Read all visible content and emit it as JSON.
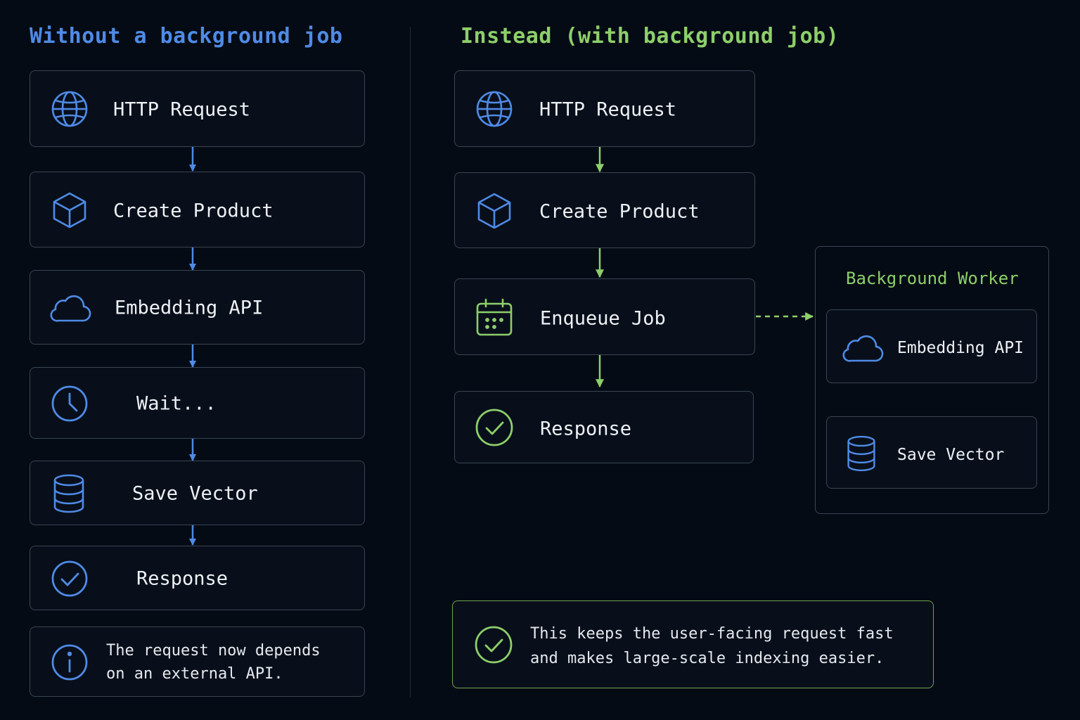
{
  "left": {
    "heading": "Without a background job",
    "steps": [
      {
        "label": "HTTP Request",
        "icon": "globe-icon"
      },
      {
        "label": "Create Product",
        "icon": "cube-icon"
      },
      {
        "label": "Embedding API",
        "icon": "cloud-icon"
      },
      {
        "label": "Wait...",
        "icon": "clock-icon"
      },
      {
        "label": "Save Vector",
        "icon": "database-icon"
      },
      {
        "label": "Response",
        "icon": "check-circle-icon"
      }
    ],
    "note": {
      "icon": "info-icon",
      "lines": [
        "The request now depends",
        "on an external API."
      ]
    }
  },
  "right": {
    "heading": "Instead (with background job)",
    "steps": [
      {
        "label": "HTTP Request",
        "icon": "globe-icon"
      },
      {
        "label": "Create Product",
        "icon": "cube-icon"
      },
      {
        "label": "Enqueue Job",
        "icon": "calendar-icon"
      },
      {
        "label": "Response",
        "icon": "check-circle-icon"
      }
    ],
    "worker": {
      "title": "Background Worker",
      "steps": [
        {
          "label": "Embedding API",
          "icon": "cloud-icon"
        },
        {
          "label": "Save Vector",
          "icon": "database-icon"
        }
      ]
    },
    "note": {
      "icon": "check-circle-icon",
      "lines": [
        "This keeps the user-facing request fast",
        "and makes large-scale indexing easier."
      ]
    }
  },
  "colors": {
    "blue": "#4f8be6",
    "green": "#8dcf6a",
    "background": "#050b14",
    "box_border": "#3a4452"
  }
}
